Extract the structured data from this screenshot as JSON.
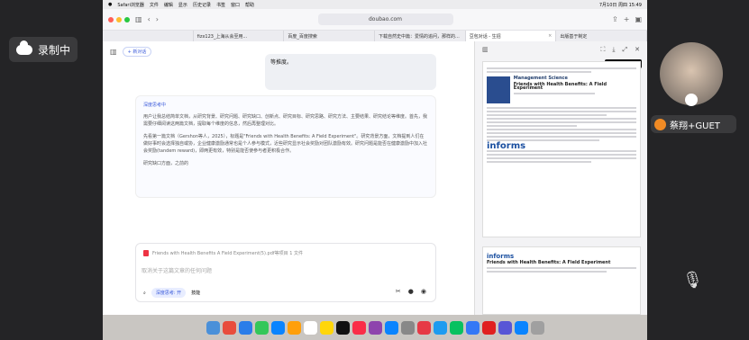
{
  "left_badge": {
    "label": "录制中"
  },
  "menubar": {
    "app": "Safari浏览器",
    "items": [
      "文件",
      "编辑",
      "显示",
      "历史记录",
      "书签",
      "窗口",
      "帮助"
    ],
    "clock": "7月10日 周四 15:49"
  },
  "toolbar": {
    "url": "doubao.com"
  },
  "tabs": [
    "",
    "fizx123_上海从会至用...",
    "百度_百度搜索",
    "下载自然史中篇：爱情的追问，那样的...",
    "豆包对话 - 生招",
    "出版基于制定"
  ],
  "chat": {
    "new_chat": "新对话",
    "bubble_text": "等推度。",
    "card_heading": "深度思考中",
    "card_p1": "用户让我总结简单文档，从研究背景、研究问题、研究缺口、创新点、研究目标、研究思路、研究方法、主要结果、研究结论等维度。首先，我需要仔细阅读这两篇文档，提取每个维度的信息，然后再整理对比。",
    "card_p2": "先看第一篇文档（Gershon等人，2025），标题是\"Friends with Health Benefits: A Field Experiment\"。研究背景方面，文档提到人们在做好事时会选择独自或协，企业健康激励通常也是个人参与模式，近些研究显示社会奖励对团队激励有效。研究问题是能否在健康激励中加入社会奖励(tandem reward)，即两更有效，特别是能否使参与者更积极合作。",
    "card_p3": "研究缺口方面，之前的",
    "attachment": "Friends with Health Benefits A Field Experiment(5).pdf等项目 1 文件",
    "placeholder": "取消关于这篇文章的任何问题",
    "btn_deep": "深度思考: 开",
    "btn_skill": "技能"
  },
  "pdf": {
    "tooltip": "选中'AI 编辑' 模式",
    "journal": "Management Science",
    "paper_title": "Friends with Health Benefits: A Field Experiment",
    "publisher": "informs"
  },
  "participant": {
    "name": "蔡翔+GUET"
  }
}
